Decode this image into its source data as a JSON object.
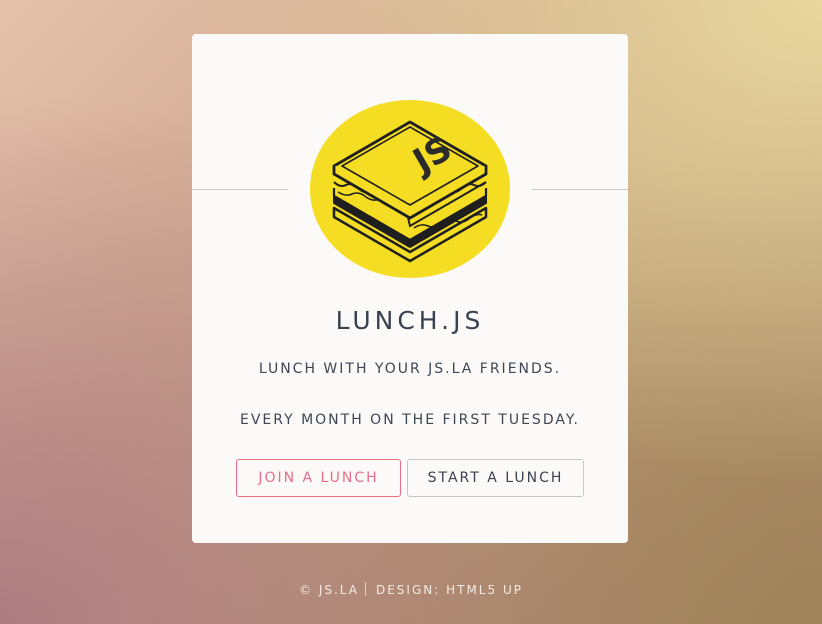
{
  "card": {
    "title": "LUNCH.JS",
    "tagline": "LUNCH WITH YOUR JS.LA FRIENDS.",
    "schedule": "EVERY MONTH ON THE FIRST TUESDAY.",
    "join_label": "JOIN A LUNCH",
    "start_label": "START A LUNCH",
    "logo_text": "JS",
    "logo_icon": "js-sandwich-logo"
  },
  "footer": {
    "copyright": "© JS.LA",
    "design": "DESIGN: HTML5 UP"
  },
  "colors": {
    "accent": "#e96d8a",
    "logo_yellow": "#f5dd24",
    "text": "#3a4250"
  }
}
